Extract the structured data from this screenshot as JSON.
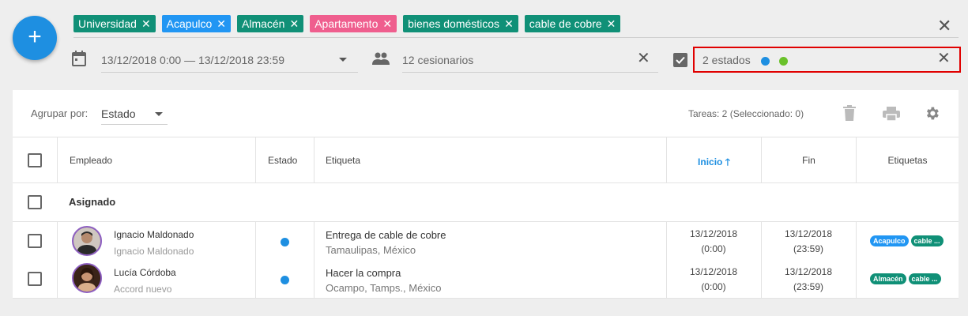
{
  "colors": {
    "accent": "#1e8fe1",
    "tag_green": "#109077",
    "tag_blue": "#2196f3",
    "tag_pink": "#ef5e8e",
    "status_blue": "#1e8fe1",
    "status_green": "#6ac12a",
    "highlight": "#e00000"
  },
  "fab": {
    "label": "+"
  },
  "tags": [
    {
      "label": "Universidad",
      "color": "#109077"
    },
    {
      "label": "Acapulco",
      "color": "#2196f3"
    },
    {
      "label": "Almacén",
      "color": "#109077"
    },
    {
      "label": "Apartamento",
      "color": "#ef5e8e"
    },
    {
      "label": "bienes domésticos",
      "color": "#109077"
    },
    {
      "label": "cable de cobre",
      "color": "#109077"
    }
  ],
  "filters": {
    "date_range": "13/12/2018 0:00 — 13/12/2018 23:59",
    "assignees": "12 cesionarios",
    "states": "2 estados"
  },
  "toolbar": {
    "group_label": "Agrupar por:",
    "group_value": "Estado",
    "task_count": "Tareas: 2 (Seleccionado: 0)"
  },
  "columns": {
    "employee": "Empleado",
    "status": "Estado",
    "label": "Etiqueta",
    "start": "Inicio",
    "end": "Fin",
    "tags": "Etiquetas"
  },
  "group_name": "Asignado",
  "rows": [
    {
      "employee_name": "Ignacio Maldonado",
      "employee_sub": "Ignacio Maldonado",
      "status_color": "#1e8fe1",
      "title": "Entrega de cable de cobre",
      "location": "Tamaulipas, México",
      "start_date": "13/12/2018",
      "start_time": "(0:00)",
      "end_date": "13/12/2018",
      "end_time": "(23:59)",
      "tags": [
        {
          "label": "Acapulco",
          "color": "#2196f3"
        },
        {
          "label": "cable ...",
          "color": "#109077"
        }
      ]
    },
    {
      "employee_name": "Lucía Córdoba",
      "employee_sub": "Accord nuevo",
      "status_color": "#1e8fe1",
      "title": "Hacer la compra",
      "location": "Ocampo, Tamps., México",
      "start_date": "13/12/2018",
      "start_time": "(0:00)",
      "end_date": "13/12/2018",
      "end_time": "(23:59)",
      "tags": [
        {
          "label": "Almacén",
          "color": "#109077"
        },
        {
          "label": "cable ...",
          "color": "#109077"
        }
      ]
    }
  ]
}
